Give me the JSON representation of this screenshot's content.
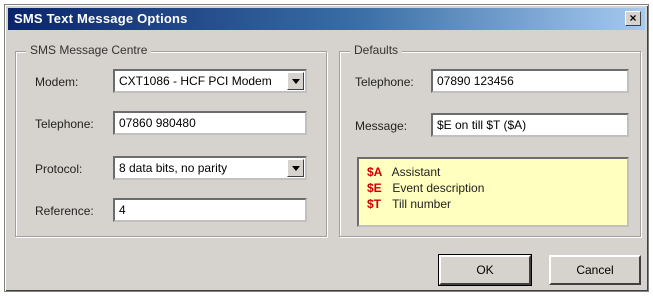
{
  "window": {
    "title": "SMS Text Message Options",
    "close_glyph": "×"
  },
  "centre": {
    "label": "SMS Message Centre",
    "modem_label": "Modem:",
    "modem_value": "CXT1086 - HCF PCI Modem",
    "telephone_label": "Telephone:",
    "telephone_value": "07860 980480",
    "protocol_label": "Protocol:",
    "protocol_value": "8 data bits, no parity",
    "reference_label": "Reference:",
    "reference_value": "4"
  },
  "defaults": {
    "label": "Defaults",
    "telephone_label": "Telephone:",
    "telephone_value": "07890 123456",
    "message_label": "Message:",
    "message_value": "$E on till $T ($A)"
  },
  "legend": [
    {
      "code": "$A",
      "desc": "Assistant"
    },
    {
      "code": "$E",
      "desc": "Event description"
    },
    {
      "code": "$T",
      "desc": "Till number"
    }
  ],
  "buttons": {
    "ok": "OK",
    "cancel": "Cancel"
  },
  "colors": {
    "legend_code": "#cc0000",
    "legend_bg": "#ffffc0",
    "titlebar": "#0a246a"
  }
}
